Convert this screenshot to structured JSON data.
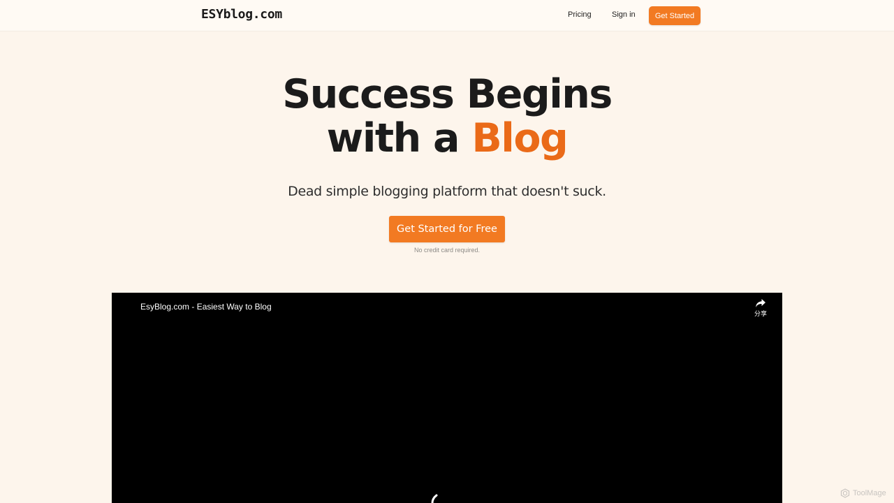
{
  "header": {
    "logo": "ESYblog.com",
    "nav": {
      "pricing": "Pricing",
      "sign_in": "Sign in",
      "get_started": "Get Started"
    }
  },
  "hero": {
    "title_line1": "Success Begins",
    "title_line2_prefix": "with a ",
    "title_line2_accent": "Blog",
    "subtitle": "Dead simple blogging platform that doesn't suck.",
    "cta_label": "Get Started for Free",
    "note": "No credit card required."
  },
  "video": {
    "title": "EsyBlog.com - Easiest Way to Blog",
    "share_label": "分享",
    "share_icon": "share-arrow-icon",
    "loading_icon": "spinner-icon"
  },
  "watermark": {
    "text": "ToolMage",
    "icon": "toolmage-logo-icon"
  },
  "colors": {
    "accent": "#f27a22",
    "accent_text": "#ea6a18",
    "page_background": "#fdf5ec",
    "video_background": "#000000"
  }
}
